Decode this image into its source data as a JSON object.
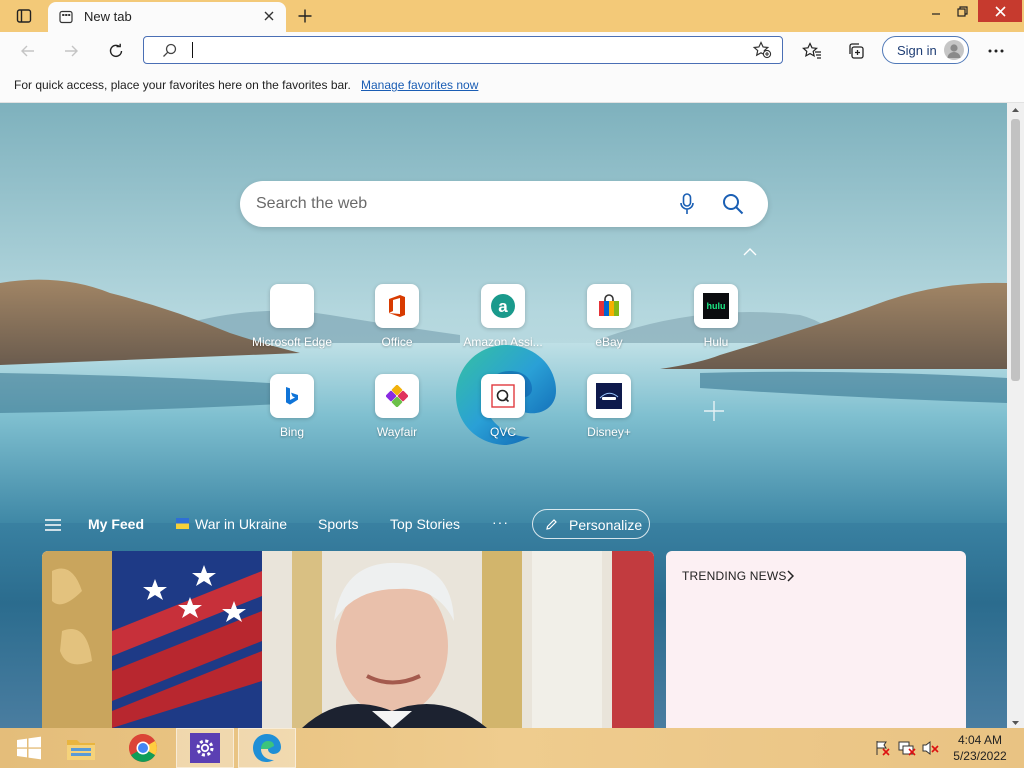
{
  "browser": {
    "tab": {
      "title": "New tab",
      "icon": "new-tab-page-icon"
    },
    "address": {
      "value": "",
      "placeholder": ""
    },
    "signin_label": "Sign in"
  },
  "favbar": {
    "text": "For quick access, place your favorites here on the favorites bar.",
    "link": "Manage favorites now"
  },
  "newtab": {
    "search_placeholder": "Search the web",
    "tiles": [
      {
        "label": "Microsoft Edge",
        "icon": "blank-icon"
      },
      {
        "label": "Office",
        "icon": "office-icon"
      },
      {
        "label": "Amazon Assi...",
        "icon": "amazon-assistant-icon"
      },
      {
        "label": "eBay",
        "icon": "ebay-icon"
      },
      {
        "label": "Hulu",
        "icon": "hulu-icon"
      },
      {
        "label": "Bing",
        "icon": "bing-icon"
      },
      {
        "label": "Wayfair",
        "icon": "wayfair-icon"
      },
      {
        "label": "QVC",
        "icon": "qvc-icon"
      },
      {
        "label": "Disney+",
        "icon": "disney-plus-icon"
      }
    ],
    "hulu_text": "hulu"
  },
  "feed": {
    "tabs": [
      "My Feed",
      "War in Ukraine",
      "Sports",
      "Top Stories"
    ],
    "more": "···",
    "personalize": "Personalize",
    "trending": "TRENDING NEWS"
  },
  "taskbar": {
    "apps": [
      "start-icon",
      "file-explorer-icon",
      "chrome-icon",
      "settings-app-icon",
      "edge-icon"
    ],
    "time": "4:04 AM",
    "date": "5/23/2022"
  },
  "colors": {
    "titlebar": "#f3c978",
    "accent": "#1a5db4",
    "edge_blue": "#0c6dc8",
    "edge_green": "#3cc47c"
  }
}
